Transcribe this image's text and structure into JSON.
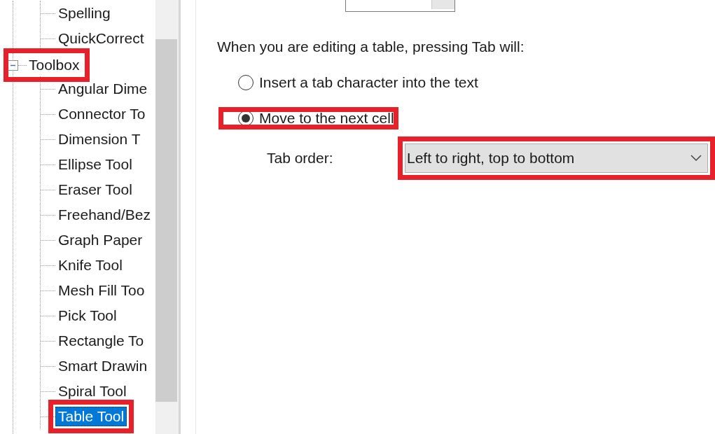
{
  "tree": {
    "continued_children": [
      {
        "label": "Spelling",
        "selected": false,
        "highlighted": false
      },
      {
        "label": "QuickCorrect",
        "selected": false,
        "highlighted": false
      }
    ],
    "items": [
      {
        "label": "Toolbox",
        "expanded": true,
        "highlighted": true,
        "children": [
          {
            "label": "Angular Dime",
            "selected": false,
            "highlighted": false
          },
          {
            "label": "Connector To",
            "selected": false,
            "highlighted": false
          },
          {
            "label": "Dimension T",
            "selected": false,
            "highlighted": false
          },
          {
            "label": "Ellipse Tool",
            "selected": false,
            "highlighted": false
          },
          {
            "label": "Eraser Tool",
            "selected": false,
            "highlighted": false
          },
          {
            "label": "Freehand/Bez",
            "selected": false,
            "highlighted": false
          },
          {
            "label": "Graph Paper",
            "selected": false,
            "highlighted": false
          },
          {
            "label": "Knife Tool",
            "selected": false,
            "highlighted": false
          },
          {
            "label": "Mesh Fill Too",
            "selected": false,
            "highlighted": false
          },
          {
            "label": "Pick Tool",
            "selected": false,
            "highlighted": false
          },
          {
            "label": "Rectangle To",
            "selected": false,
            "highlighted": false
          },
          {
            "label": "Smart Drawin",
            "selected": false,
            "highlighted": false
          },
          {
            "label": "Spiral Tool",
            "selected": false,
            "highlighted": false
          },
          {
            "label": "Table Tool",
            "selected": true,
            "highlighted": true
          }
        ]
      }
    ]
  },
  "panel": {
    "prompt": "When you are editing a table, pressing Tab will:",
    "options": [
      {
        "label": "Insert a tab character into the text",
        "selected": false,
        "highlighted": false
      },
      {
        "label": "Move to the next cell",
        "selected": true,
        "highlighted": true
      }
    ],
    "tab_order": {
      "label": "Tab order:",
      "value": "Left to right, top to bottom",
      "highlighted": true
    }
  }
}
